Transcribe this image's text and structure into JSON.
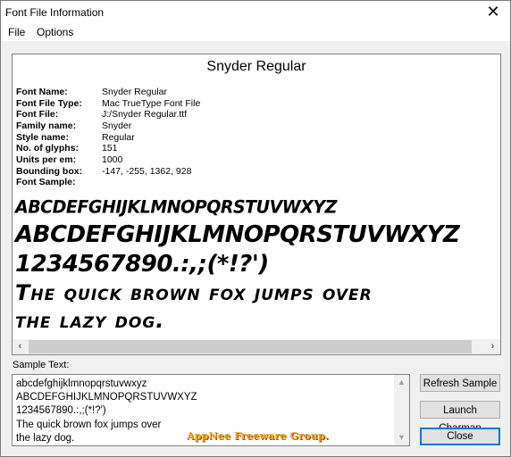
{
  "window": {
    "title": "Font File Information",
    "close_glyph": "✕"
  },
  "menu": {
    "items": [
      {
        "label": "File"
      },
      {
        "label": "Options"
      }
    ]
  },
  "info": {
    "heading": "Snyder Regular",
    "properties": [
      {
        "label": "Font Name:",
        "value": "Snyder Regular"
      },
      {
        "label": "Font File Type:",
        "value": "Mac TrueType Font File"
      },
      {
        "label": "Font File:",
        "value": "J:/Snyder Regular.ttf"
      },
      {
        "label": "Family name:",
        "value": "Snyder"
      },
      {
        "label": "Style name:",
        "value": "Regular"
      },
      {
        "label": "No. of glyphs:",
        "value": "151"
      },
      {
        "label": "Units per em:",
        "value": "1000"
      },
      {
        "label": "Bounding box:",
        "value": "-147, -255, 1362, 928"
      }
    ],
    "sample_label": "Font Sample:",
    "sample_lines": [
      "ABCDEFGHIJKLMNOPQRSTUVWXYZ",
      "ABCDEFGHIJKLMNOPQRSTUVWXYZ",
      "1234567890.:,;(*!?')",
      "The quick brown fox jumps over",
      "the lazy dog."
    ],
    "scroll_left_glyph": "‹",
    "scroll_right_glyph": "›"
  },
  "sample_text": {
    "label": "Sample Text:",
    "value": "abcdefghijklmnopqrstuvwxyz\nABCDEFGHIJKLMNOPQRSTUVWXYZ\n1234567890.:,;(*!?')\nThe quick brown fox jumps over\nthe lazy dog.",
    "scroll_up_glyph": "▲",
    "scroll_down_glyph": "▼",
    "watermark": "AppNee Freeware Group."
  },
  "buttons": {
    "refresh": "Refresh Sample",
    "charmap": "Launch Charmap",
    "close": "Close"
  }
}
